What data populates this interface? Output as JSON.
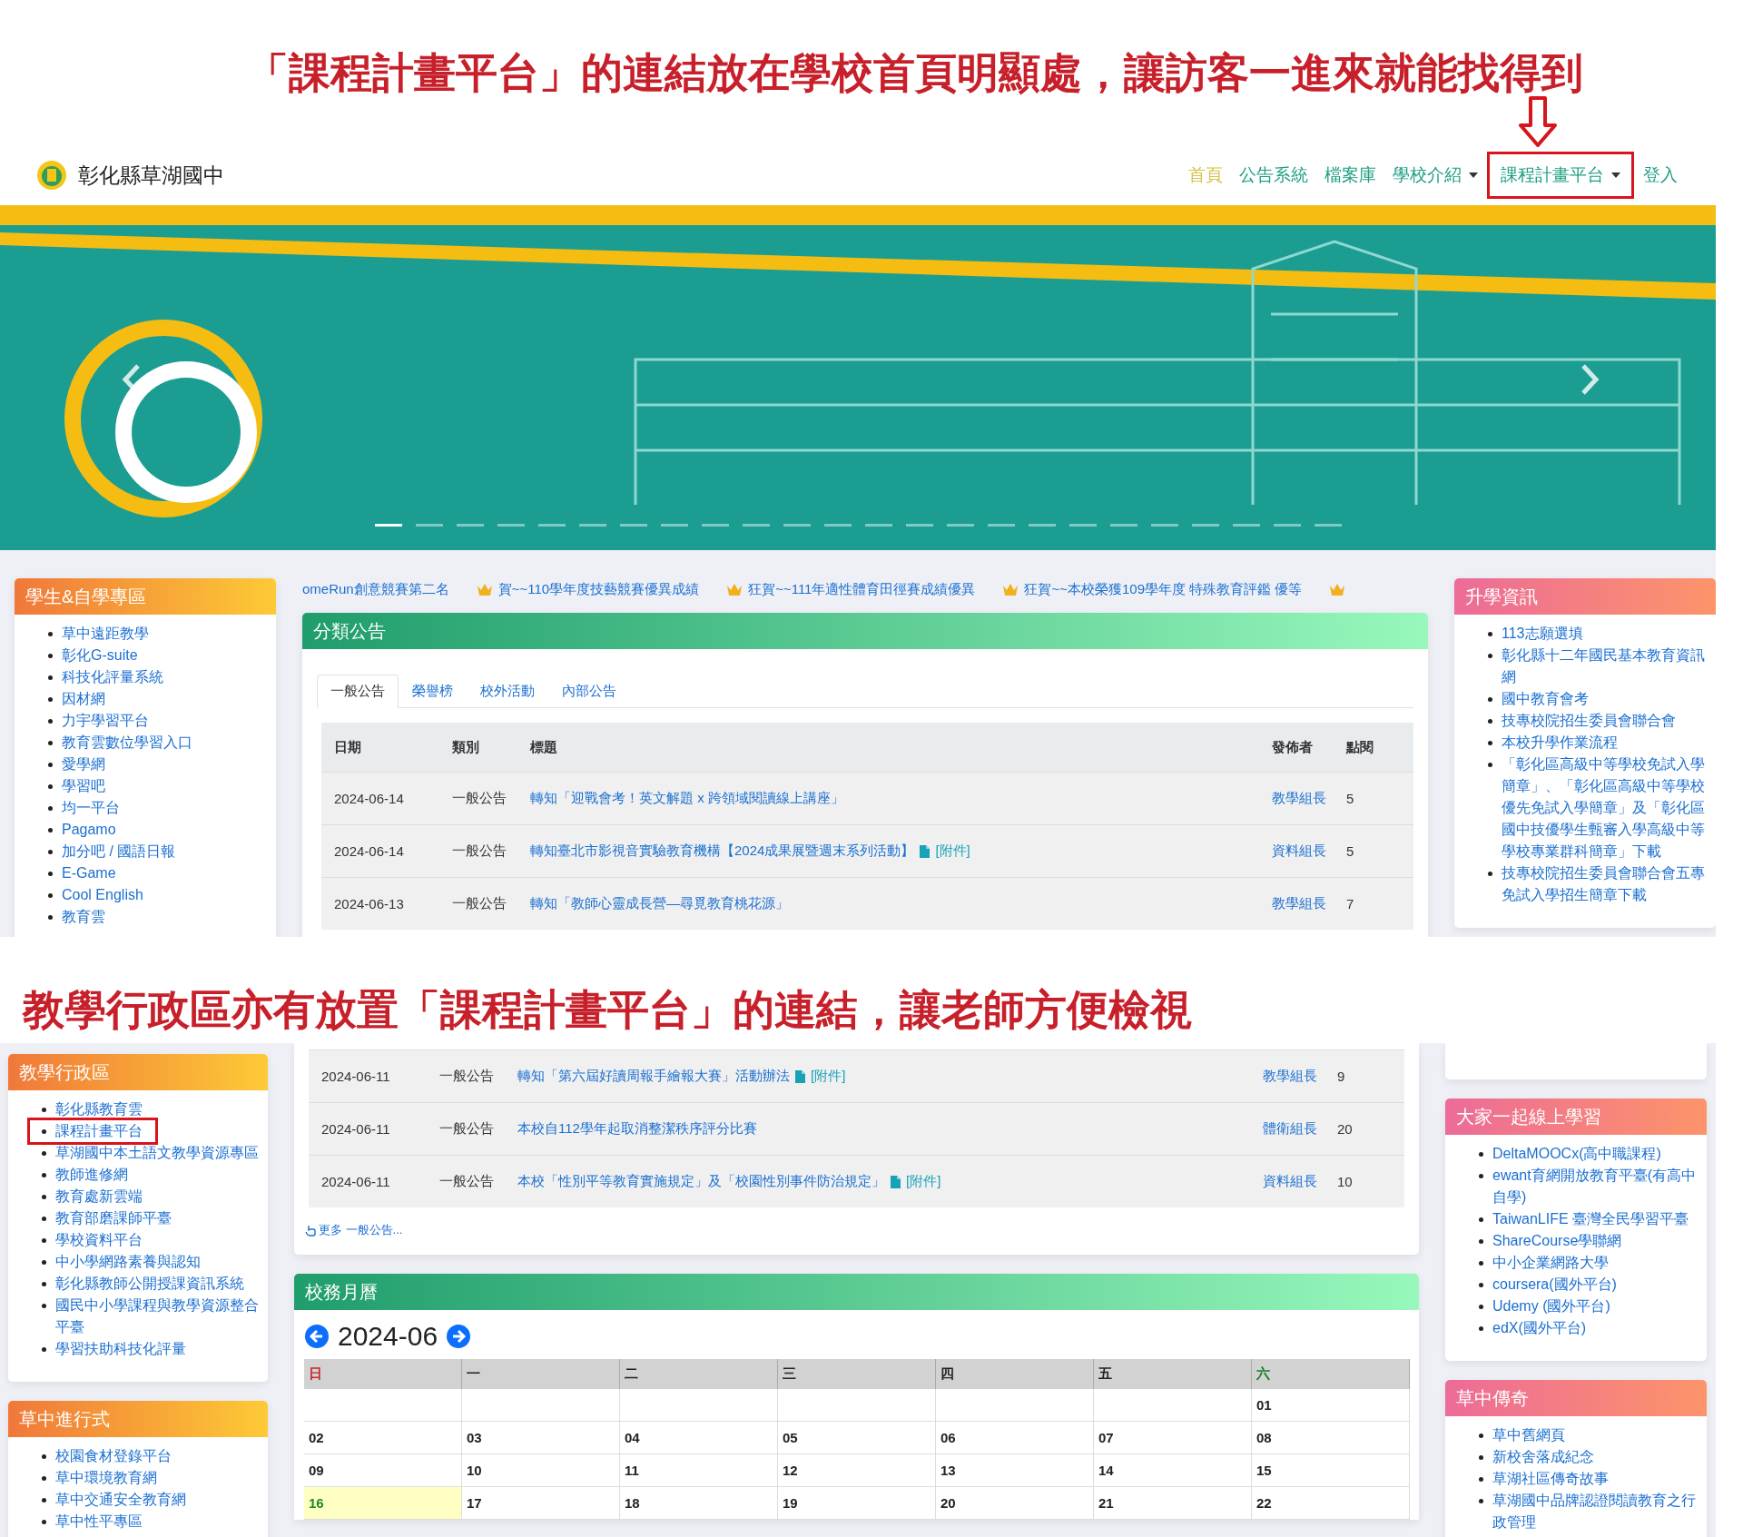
{
  "top_note": "「課程計畫平台」的連結放在學校首頁明顯處，讓訪客一進來就能找得到",
  "screenshot_1": {
    "navbar": {
      "brand": "彰化縣草湖國中",
      "items": [
        {
          "label": "首頁",
          "active": true,
          "dropdown": false,
          "highlighted": false
        },
        {
          "label": "公告系統",
          "active": false,
          "dropdown": false,
          "highlighted": false
        },
        {
          "label": "檔案庫",
          "active": false,
          "dropdown": false,
          "highlighted": false
        },
        {
          "label": "學校介紹",
          "active": false,
          "dropdown": true,
          "highlighted": false
        },
        {
          "label": "課程計畫平台",
          "active": false,
          "dropdown": true,
          "highlighted": true
        },
        {
          "label": "登入",
          "active": false,
          "dropdown": false,
          "highlighted": false
        }
      ]
    },
    "banner": {
      "slides": [
        {
          "selected": true
        },
        {
          "selected": false
        },
        {
          "selected": false
        },
        {
          "selected": false
        },
        {
          "selected": false
        },
        {
          "selected": false
        },
        {
          "selected": false
        },
        {
          "selected": false
        },
        {
          "selected": false
        },
        {
          "selected": false
        },
        {
          "selected": false
        },
        {
          "selected": false
        },
        {
          "selected": false
        },
        {
          "selected": false
        },
        {
          "selected": false
        },
        {
          "selected": false
        },
        {
          "selected": false
        },
        {
          "selected": false
        },
        {
          "selected": false
        },
        {
          "selected": false
        },
        {
          "selected": false
        },
        {
          "selected": false
        },
        {
          "selected": false
        },
        {
          "selected": false
        }
      ]
    },
    "left_cards": [
      {
        "title": "學生&自學專區",
        "items": [
          {
            "label": "草中遠距教學",
            "highlighted": false
          },
          {
            "label": "彰化G-suite",
            "highlighted": false
          },
          {
            "label": "科技化評量系統",
            "highlighted": false
          },
          {
            "label": "因材網",
            "highlighted": false
          },
          {
            "label": "力宇學習平台",
            "highlighted": false
          },
          {
            "label": "教育雲數位學習入口",
            "highlighted": false
          },
          {
            "label": "愛學網",
            "highlighted": false
          },
          {
            "label": "學習吧",
            "highlighted": false
          },
          {
            "label": "均一平台",
            "highlighted": false
          },
          {
            "label": "Pagamo",
            "highlighted": false
          },
          {
            "label": "加分吧 / 國語日報",
            "highlighted": false
          },
          {
            "label": "E-Game",
            "highlighted": false
          },
          {
            "label": "Cool English",
            "highlighted": false
          },
          {
            "label": "教育雲",
            "highlighted": false
          }
        ]
      }
    ],
    "marquee": [
      {
        "text": "omeRun創意競賽第二名",
        "crown": false
      },
      {
        "text": "賀~~110學年度技藝競賽優異成績",
        "crown": true
      },
      {
        "text": "狂賀~~111年適性體育田徑賽成績優異",
        "crown": true
      },
      {
        "text": "狂賀~~本校榮獲109學年度 特殊教育評鑑 優等",
        "crown": true
      },
      {
        "crown": true
      }
    ],
    "announcements": {
      "title": "分類公告",
      "tabs": [
        {
          "label": "一般公告",
          "selected": true
        },
        {
          "label": "榮譽榜",
          "selected": false
        },
        {
          "label": "校外活動",
          "selected": false
        },
        {
          "label": "內部公告",
          "selected": false
        }
      ],
      "columns": [
        "日期",
        "類別",
        "標題",
        "發佈者",
        "點閱"
      ],
      "rows": [
        {
          "date": "2024-06-14",
          "category": "一般公告",
          "title": "轉知「迎戰會考！英文解題 x 跨領域閱讀線上講座」",
          "publisher": "教學組長",
          "clicks": "5"
        },
        {
          "date": "2024-06-14",
          "category": "一般公告",
          "title": "轉知臺北市影視音實驗教育機構【2024成果展暨週末系列活動】",
          "attachment": "[附件]",
          "publisher": "資料組長",
          "clicks": "5"
        },
        {
          "date": "2024-06-13",
          "category": "一般公告",
          "title": "轉知「教師心靈成長營—尋覓教育桃花源」",
          "publisher": "教學組長",
          "clicks": "7"
        }
      ]
    },
    "right_cards": [
      {
        "title": "升學資訊",
        "items": [
          {
            "label": "113志願選填",
            "highlighted": false
          },
          {
            "label": "彰化縣十二年國民基本教育資訊網",
            "highlighted": false
          },
          {
            "label": "國中教育會考",
            "highlighted": false
          },
          {
            "label": "技專校院招生委員會聯合會",
            "highlighted": false
          },
          {
            "label": "本校升學作業流程",
            "highlighted": false
          },
          {
            "label": "「彰化區高級中等學校免試入學簡章」、「彰化區高級中等學校優先免試入學簡章」及「彰化區國中技優學生甄審入學高級中等學校專業群科簡章」下載",
            "highlighted": false
          },
          {
            "label": "技專校院招生委員會聯合會五專免試入學招生簡章下載",
            "highlighted": false
          }
        ]
      }
    ]
  },
  "middle_note": "教學行政區亦有放置「課程計畫平台」的連結，讓老師方便檢視",
  "screenshot_2": {
    "left_cards": [
      {
        "title": "教學行政區",
        "items": [
          {
            "label": "彰化縣教育雲",
            "highlighted": false
          },
          {
            "label": "課程計畫平台",
            "highlighted": true
          },
          {
            "label": "草湖國中本土語文教學資源專區",
            "highlighted": false
          },
          {
            "label": "教師進修網",
            "highlighted": false
          },
          {
            "label": "教育處新雲端",
            "highlighted": false
          },
          {
            "label": "教育部磨課師平臺",
            "highlighted": false
          },
          {
            "label": "學校資料平台",
            "highlighted": false
          },
          {
            "label": "中小學網路素養與認知",
            "highlighted": false
          },
          {
            "label": "彰化縣教師公開授課資訊系統",
            "highlighted": false
          },
          {
            "label": "國民中小學課程與教學資源整合平臺",
            "highlighted": false
          },
          {
            "label": "學習扶助科技化評量",
            "highlighted": false
          }
        ]
      },
      {
        "title": "草中進行式",
        "items": [
          {
            "label": "校園食材登錄平台",
            "highlighted": false
          },
          {
            "label": "草中環境教育網",
            "highlighted": false
          },
          {
            "label": "草中交通安全教育網",
            "highlighted": false
          },
          {
            "label": "草中性平專區",
            "highlighted": false
          }
        ]
      }
    ],
    "announcement_rows": [
      {
        "date": "2024-06-11",
        "category": "一般公告",
        "title": "轉知「第六屆好讀周報手繪報大賽」活動辦法",
        "attachment": "[附件]",
        "publisher": "教學組長",
        "clicks": "9"
      },
      {
        "date": "2024-06-11",
        "category": "一般公告",
        "title": "本校自112學年起取消整潔秩序評分比賽",
        "publisher": "體衛組長",
        "clicks": "20"
      },
      {
        "date": "2024-06-11",
        "category": "一般公告",
        "title": "本校「性別平等教育實施規定」及「校園性別事件防治規定」",
        "attachment": "[附件]",
        "publisher": "資料組長",
        "clicks": "10"
      }
    ],
    "more_link": "更多 一般公告...",
    "calendar": {
      "title": "校務月曆",
      "month": "2024-06",
      "weekdays": [
        {
          "label": "日",
          "color": "#c62828"
        },
        {
          "label": "一",
          "color": "#222222"
        },
        {
          "label": "二",
          "color": "#222222"
        },
        {
          "label": "三",
          "color": "#222222"
        },
        {
          "label": "四",
          "color": "#222222"
        },
        {
          "label": "五",
          "color": "#222222"
        },
        {
          "label": "六",
          "color": "#1b7a2a"
        }
      ],
      "weeks": [
        [
          {
            "kind": "blank"
          },
          {
            "kind": "blank"
          },
          {
            "kind": "blank"
          },
          {
            "kind": "blank"
          },
          {
            "kind": "blank"
          },
          {
            "kind": "blank"
          },
          {
            "kind": "day",
            "day": "01",
            "today": false
          }
        ],
        [
          {
            "kind": "day",
            "day": "02",
            "today": false
          },
          {
            "kind": "day",
            "day": "03",
            "today": false
          },
          {
            "kind": "day",
            "day": "04",
            "today": false
          },
          {
            "kind": "day",
            "day": "05",
            "today": false
          },
          {
            "kind": "day",
            "day": "06",
            "today": false
          },
          {
            "kind": "day",
            "day": "07",
            "today": false
          },
          {
            "kind": "day",
            "day": "08",
            "today": false
          }
        ],
        [
          {
            "kind": "day",
            "day": "09",
            "today": false
          },
          {
            "kind": "day",
            "day": "10",
            "today": false
          },
          {
            "kind": "day",
            "day": "11",
            "today": false
          },
          {
            "kind": "day",
            "day": "12",
            "today": false
          },
          {
            "kind": "day",
            "day": "13",
            "today": false
          },
          {
            "kind": "day",
            "day": "14",
            "today": false
          },
          {
            "kind": "day",
            "day": "15",
            "today": false
          }
        ],
        [
          {
            "kind": "day",
            "day": "16",
            "today": true
          },
          {
            "kind": "day",
            "day": "17",
            "today": false
          },
          {
            "kind": "day",
            "day": "18",
            "today": false
          },
          {
            "kind": "day",
            "day": "19",
            "today": false
          },
          {
            "kind": "day",
            "day": "20",
            "today": false
          },
          {
            "kind": "day",
            "day": "21",
            "today": false
          },
          {
            "kind": "day",
            "day": "22",
            "today": false
          }
        ]
      ]
    },
    "right_cards": [
      {
        "title": "大家一起線上學習",
        "items": [
          {
            "label": "DeltaMOOCx(高中職課程)",
            "highlighted": false
          },
          {
            "label": "ewant育網開放教育平臺(有高中自學)",
            "highlighted": false
          },
          {
            "label": "TaiwanLIFE 臺灣全民學習平臺",
            "highlighted": false
          },
          {
            "label": "ShareCourse學聯網",
            "highlighted": false
          },
          {
            "label": "中小企業網路大學",
            "highlighted": false
          },
          {
            "label": "coursera(國外平台)",
            "highlighted": false
          },
          {
            "label": "Udemy (國外平台)",
            "highlighted": false
          },
          {
            "label": "edX(國外平台)",
            "highlighted": false
          }
        ]
      },
      {
        "title": "草中傳奇",
        "items": [
          {
            "label": "草中舊網頁",
            "highlighted": false
          },
          {
            "label": "新校舍落成紀念",
            "highlighted": false
          },
          {
            "label": "草湖社區傳奇故事",
            "highlighted": false
          },
          {
            "label": "草湖國中品牌認證閱讀教育之行政管理",
            "highlighted": false
          }
        ]
      }
    ]
  }
}
